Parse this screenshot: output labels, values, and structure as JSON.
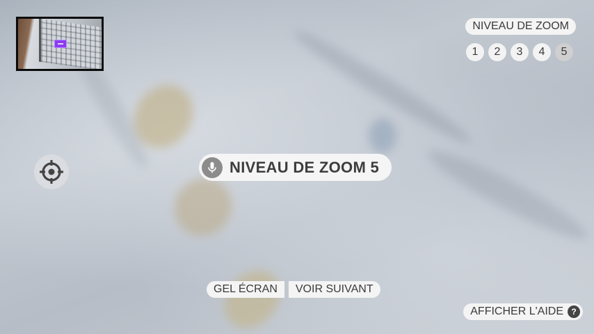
{
  "zoom": {
    "title": "NIVEAU DE ZOOM",
    "levels": [
      "1",
      "2",
      "3",
      "4",
      "5"
    ],
    "active_level": "5"
  },
  "center_label": "NIVEAU DE ZOOM 5",
  "controls": {
    "freeze_label": "GEL ÉCRAN",
    "next_label": "VOIR SUIVANT",
    "help_label": "AFFICHER L'AIDE",
    "help_icon": "?"
  },
  "icons": {
    "minimap_marker": "viewport-marker-icon",
    "mic": "microphone-icon",
    "crosshair": "crosshair-icon",
    "help": "question-icon"
  },
  "colors": {
    "minimap_marker": "#8a3cf0",
    "pill_background": "#f4f4f4",
    "pill_text": "#3a3a3a"
  }
}
